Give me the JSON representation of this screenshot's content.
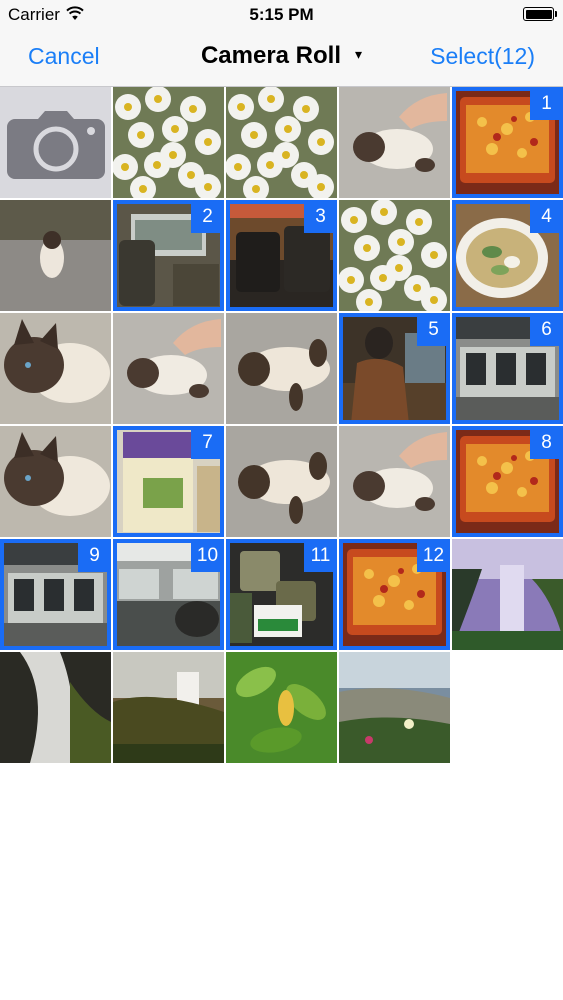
{
  "status_bar": {
    "carrier": "Carrier",
    "time": "5:15 PM"
  },
  "nav": {
    "cancel": "Cancel",
    "title": "Camera Roll",
    "caret": "▾",
    "select": "Select(12)"
  },
  "colors": {
    "accent": "#1a7ef7",
    "selection": "#1a6cf5"
  },
  "camera_tile": {
    "icon": "camera-icon"
  },
  "photos": [
    {
      "kind": "flowers"
    },
    {
      "kind": "flowers"
    },
    {
      "kind": "cat-hand"
    },
    {
      "kind": "food",
      "badge": "1"
    },
    {
      "kind": "cat-gravel"
    },
    {
      "kind": "train-seat",
      "badge": "2"
    },
    {
      "kind": "bags",
      "badge": "3"
    },
    {
      "kind": "flowers"
    },
    {
      "kind": "noodles",
      "badge": "4"
    },
    {
      "kind": "cat-face"
    },
    {
      "kind": "cat-hand"
    },
    {
      "kind": "cat-lying"
    },
    {
      "kind": "person",
      "badge": "5"
    },
    {
      "kind": "station",
      "badge": "6"
    },
    {
      "kind": "cat-face"
    },
    {
      "kind": "package",
      "badge": "7"
    },
    {
      "kind": "cat-lying"
    },
    {
      "kind": "cat-hand"
    },
    {
      "kind": "food",
      "badge": "8"
    },
    {
      "kind": "station",
      "badge": "9"
    },
    {
      "kind": "train-interior",
      "badge": "10"
    },
    {
      "kind": "tea-cans",
      "badge": "11"
    },
    {
      "kind": "food",
      "badge": "12"
    },
    {
      "kind": "waterfall-purple"
    },
    {
      "kind": "waterfall-dark"
    },
    {
      "kind": "waterfall-moss"
    },
    {
      "kind": "leaves"
    },
    {
      "kind": "coast"
    }
  ]
}
